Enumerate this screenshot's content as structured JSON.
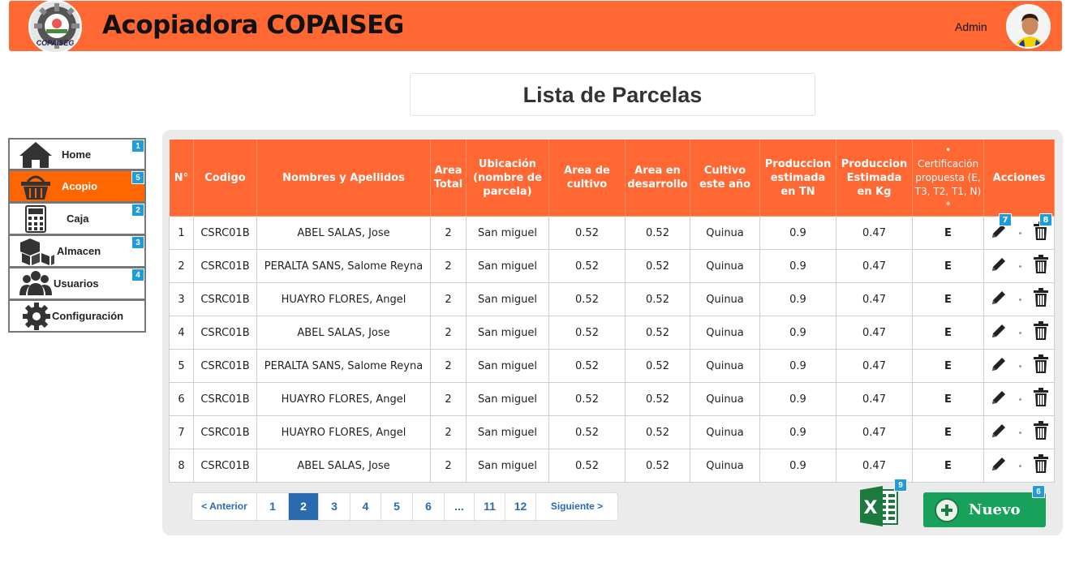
{
  "header": {
    "app_title": "Acopiadora COPAISEG",
    "logo_text": "COPAISEG",
    "user_name": "Admin"
  },
  "page": {
    "title": "Lista de Parcelas"
  },
  "sidebar": {
    "items": [
      {
        "label": "Home",
        "icon": "home-icon",
        "badge": "1",
        "active": false
      },
      {
        "label": "Acopio",
        "icon": "basket-icon",
        "badge": "5",
        "active": true
      },
      {
        "label": "Caja",
        "icon": "calculator-icon",
        "badge": "2",
        "active": false
      },
      {
        "label": "Almacen",
        "icon": "boxes-icon",
        "badge": "3",
        "active": false
      },
      {
        "label": "Usuarios",
        "icon": "users-icon",
        "badge": "4",
        "active": false
      },
      {
        "label": "Configuración",
        "icon": "gear-icon",
        "badge": "",
        "active": false
      }
    ]
  },
  "table": {
    "headers": [
      "N°",
      "Codigo",
      "Nombres y Apellidos",
      "Area Total",
      "Ubicación (nombre de parcela)",
      "Area de cultivo",
      "Area en desarrollo",
      "Cultivo este año",
      "Produccion estimada en TN",
      "Produccion Estimada en Kg",
      "• Certificación propuesta (E, T3, T2, T1, N) *",
      "Acciones"
    ],
    "rows": [
      [
        "1",
        "CSRC01B",
        "ABEL SALAS, Jose",
        "2",
        "San miguel",
        "0.52",
        "0.52",
        "Quinua",
        "0.9",
        "0.47",
        "E"
      ],
      [
        "2",
        "CSRC01B",
        "PERALTA SANS, Salome Reyna",
        "2",
        "San miguel",
        "0.52",
        "0.52",
        "Quinua",
        "0.9",
        "0.47",
        "E"
      ],
      [
        "3",
        "CSRC01B",
        "HUAYRO FLORES, Angel",
        "2",
        "San miguel",
        "0.52",
        "0.52",
        "Quinua",
        "0.9",
        "0.47",
        "E"
      ],
      [
        "4",
        "CSRC01B",
        "ABEL SALAS, Jose",
        "2",
        "San miguel",
        "0.52",
        "0.52",
        "Quinua",
        "0.9",
        "0.47",
        "E"
      ],
      [
        "5",
        "CSRC01B",
        "PERALTA SANS, Salome Reyna",
        "2",
        "San miguel",
        "0.52",
        "0.52",
        "Quinua",
        "0.9",
        "0.47",
        "E"
      ],
      [
        "6",
        "CSRC01B",
        "HUAYRO FLORES, Angel",
        "2",
        "San miguel",
        "0.52",
        "0.52",
        "Quinua",
        "0.9",
        "0.47",
        "E"
      ],
      [
        "7",
        "CSRC01B",
        "HUAYRO FLORES, Angel",
        "2",
        "San miguel",
        "0.52",
        "0.52",
        "Quinua",
        "0.9",
        "0.47",
        "E"
      ],
      [
        "8",
        "CSRC01B",
        "ABEL SALAS, Jose",
        "2",
        "San miguel",
        "0.52",
        "0.52",
        "Quinua",
        "0.9",
        "0.47",
        "E"
      ]
    ],
    "action_badges": {
      "edit": "7",
      "delete": "8"
    }
  },
  "pagination": {
    "prev": "< Anterior",
    "pages": [
      "1",
      "2",
      "3",
      "4",
      "5",
      "6",
      "...",
      "11",
      "12"
    ],
    "current": "2",
    "next": "Siguiente >"
  },
  "buttons": {
    "excel_badge": "9",
    "new_label": "Nuevo",
    "new_badge": "6"
  },
  "colors": {
    "header": "#ff6733",
    "active_menu": "#ff6600",
    "badge": "#1f9cd9",
    "new_button": "#17a15a",
    "pager_link": "#2a6bb0"
  }
}
